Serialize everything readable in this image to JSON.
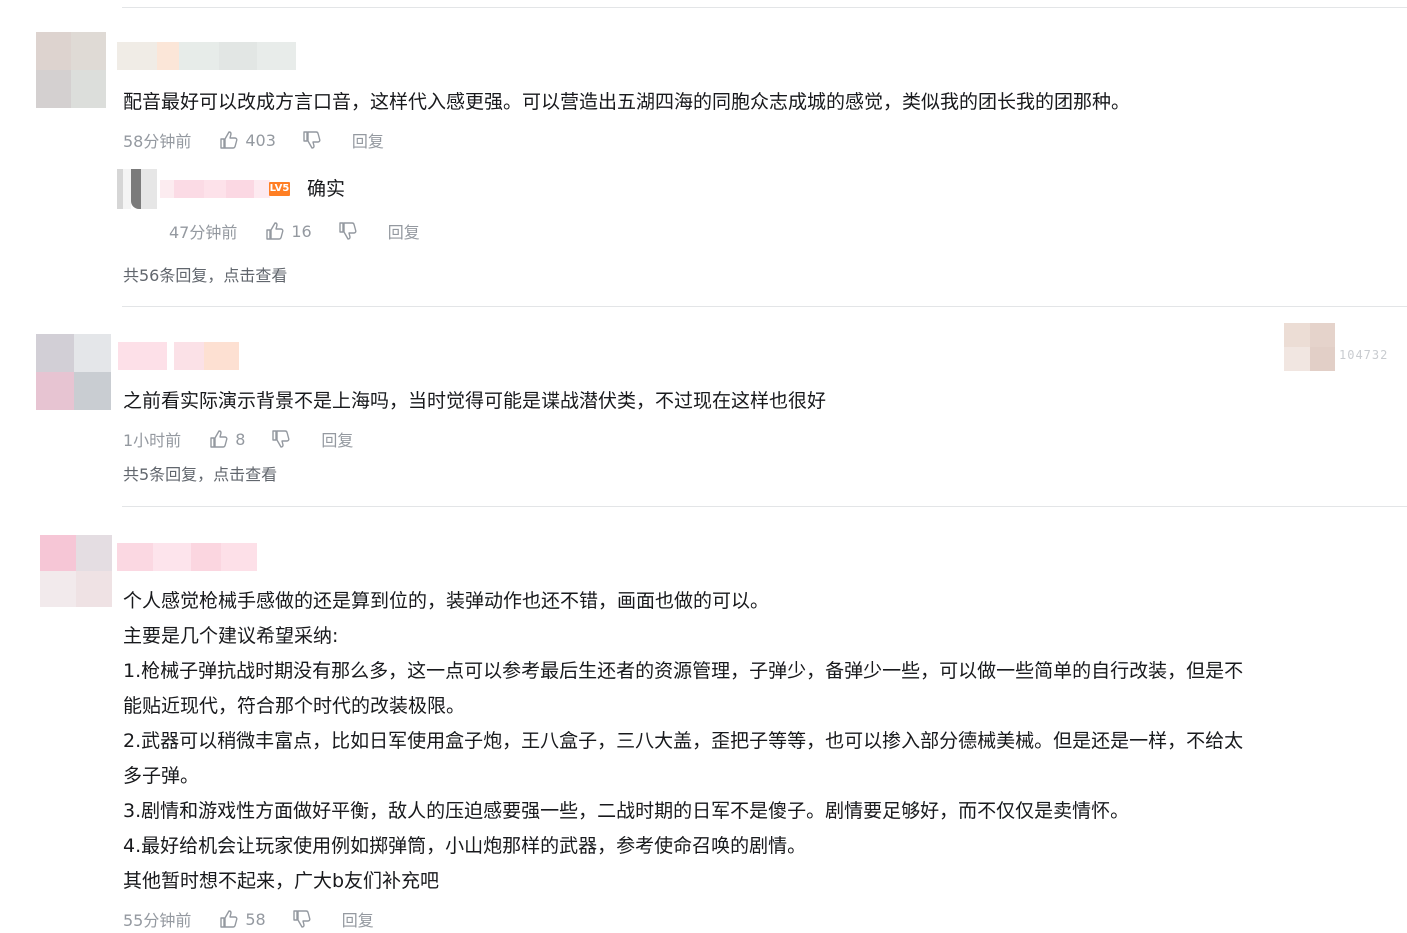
{
  "comments": [
    {
      "text_lines": [
        "配音最好可以改成方言口音，这样代入感更强。可以营造出五湖四海的同胞众志成城的感觉，类似我的团长我的团那种。"
      ],
      "time": "58分钟前",
      "likes": "403",
      "reply_label": "回复",
      "sub_reply": {
        "level_badge": "LV5",
        "text": "确实",
        "time": "47分钟前",
        "likes": "16",
        "reply_label": "回复"
      },
      "more_replies": "共56条回复，点击查看"
    },
    {
      "text_lines": [
        "之前看实际演示背景不是上海吗，当时觉得可能是谍战潜伏类，不过现在这样也很好"
      ],
      "time": "1小时前",
      "likes": "8",
      "reply_label": "回复",
      "fan_badge_number": "104732",
      "more_replies": "共5条回复，点击查看"
    },
    {
      "text_lines": [
        "个人感觉枪械手感做的还是算到位的，装弹动作也还不错，画面也做的可以。",
        "主要是几个建议希望采纳:",
        "1.枪械子弹抗战时期没有那么多，这一点可以参考最后生还者的资源管理，子弹少，备弹少一些，可以做一些简单的自行改装，但是不",
        "能贴近现代，符合那个时代的改装极限。",
        "2.武器可以稍微丰富点，比如日军使用盒子炮，王八盒子，三八大盖，歪把子等等，也可以掺入部分德械美械。但是还是一样，不给太",
        "多子弹。",
        "3.剧情和游戏性方面做好平衡，敌人的压迫感要强一些，二战时期的日军不是傻子。剧情要足够好，而不仅仅是卖情怀。",
        "4.最好给机会让玩家使用例如掷弹筒，小山炮那样的武器，参考使命召唤的剧情。",
        "其他暂时想不起来，广大b友们补充吧"
      ],
      "time": "55分钟前",
      "likes": "58",
      "reply_label": "回复"
    }
  ],
  "colors": {
    "text": "#18191c",
    "meta": "#9499a0",
    "more": "#61666d",
    "divider": "#e3e5e7",
    "level_badge": "#ff7f24"
  },
  "icons": [
    "like-icon",
    "dislike-icon"
  ]
}
